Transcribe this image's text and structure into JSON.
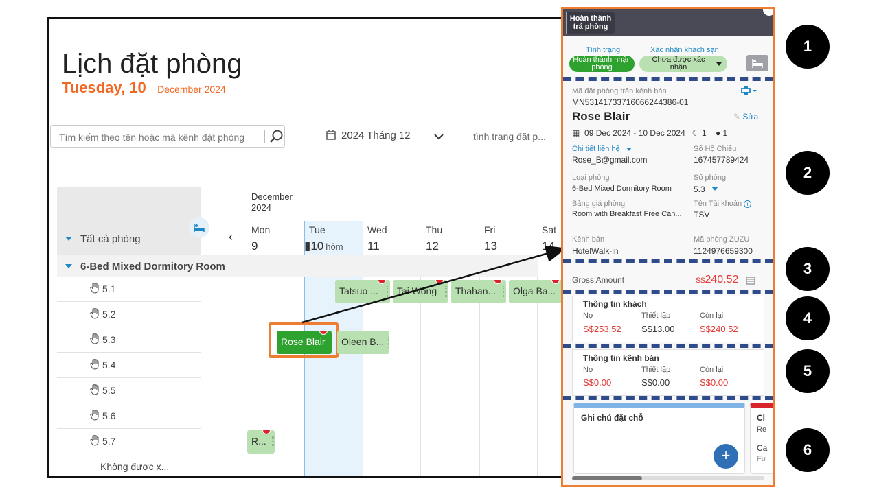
{
  "page": {
    "title": "Lịch đặt phòng",
    "day_label": "Tuesday, 10",
    "month_label": "December 2024",
    "search_placeholder": "Tìm kiếm theo tên hoặc mã kênh đặt phòng",
    "month_selector": "2024 Tháng 12",
    "status_filter": "tình trạng đặt p..."
  },
  "calendar": {
    "month_header_1": "December",
    "month_header_2": "2024",
    "all_rooms": "Tất cả phòng",
    "room_type": "6-Bed Mixed Dormitory Room",
    "unassigned": "Không được x...",
    "days": [
      {
        "name": "Mon",
        "num": "9",
        "extra": ""
      },
      {
        "name": "Tue",
        "num": "▮10",
        "extra": "hôm"
      },
      {
        "name": "Wed",
        "num": "11",
        "extra": ""
      },
      {
        "name": "Thu",
        "num": "12",
        "extra": ""
      },
      {
        "name": "Fri",
        "num": "13",
        "extra": ""
      },
      {
        "name": "Sat",
        "num": "14",
        "extra": ""
      }
    ],
    "rooms": [
      "5.1",
      "5.2",
      "5.3",
      "5.4",
      "5.5",
      "5.6",
      "5.7"
    ],
    "bookings": [
      {
        "guest": "Tatsuo ...",
        "room": "5.1"
      },
      {
        "guest": "Tai Wong",
        "room": "5.1"
      },
      {
        "guest": "Thahan...",
        "room": "5.1"
      },
      {
        "guest": "Olga Ba...",
        "room": "5.1"
      },
      {
        "guest": "Rose Blair",
        "room": "5.3"
      },
      {
        "guest": "Oleen B...",
        "room": "5.3"
      },
      {
        "guest": "R...",
        "room": "5.7"
      }
    ]
  },
  "panel": {
    "complete_checkout_line1": "Hoàn thành",
    "complete_checkout_line2": "trả phòng",
    "status_label": "Tình trạng",
    "status_value_line1": "Hoàn thành nhận",
    "status_value_line2": "phòng",
    "hotel_confirm_label": "Xác nhận khách sạn",
    "hotel_confirm_line1": "Chưa được xác",
    "hotel_confirm_line2": "nhận",
    "channel_code_label": "Mã đặt phòng trên kênh bán",
    "channel_code": "MN53141733716066244386-01",
    "guest_name": "Rose Blair",
    "edit_label": "Sửa",
    "stay_dates": "09 Dec 2024 - 10 Dec 2024",
    "nights": "1",
    "guests": "1",
    "contact_label": "Chi tiết liên hệ",
    "email": "Rose_B@gmail.com",
    "passport_label": "Số Hộ Chiếu",
    "passport": "167457789424",
    "room_type_label": "Loại phòng",
    "room_type": "6-Bed Mixed Dormitory Room",
    "room_no_label": "Số phòng",
    "room_no": "5.3",
    "rate_label": "Bảng giá phòng",
    "rate": "Room with Breakfast Free Can...",
    "account_label": "Tên Tài khoản",
    "account": "TSV",
    "channel_label": "Kênh bán",
    "channel": "HotelWalk-in",
    "zuzu_label": "Mã phòng ZUZU",
    "zuzu": "1124976659300",
    "gross_label": "Gross Amount",
    "gross_currency": "S$",
    "gross_amount": "240.52",
    "guest_info_title": "Thông tin khách",
    "debt_label": "Nợ",
    "setup_label": "Thiết lập",
    "remaining_label": "Còn lại",
    "guest_debt": "S$253.52",
    "guest_setup": "S$13.00",
    "guest_remaining": "S$240.52",
    "channel_info_title": "Thông tin kênh bán",
    "channel_debt": "S$0.00",
    "channel_setup": "S$0.00",
    "channel_remaining": "S$0.00",
    "note_title": "Ghi chú đặt chỗ",
    "side_card_t1": "Cl",
    "side_card_t2": "Re",
    "side_card_t3": "Ca",
    "side_card_t4": "Fu"
  },
  "callouts": [
    "1",
    "2",
    "3",
    "4",
    "5",
    "6"
  ],
  "colors": {
    "orange": "#f26722",
    "highlight": "#ee7d31",
    "booking": "#b8e0b0",
    "booking_active": "#2ea22e",
    "link": "#1e88c7",
    "dashes": "#2f4b8a"
  }
}
